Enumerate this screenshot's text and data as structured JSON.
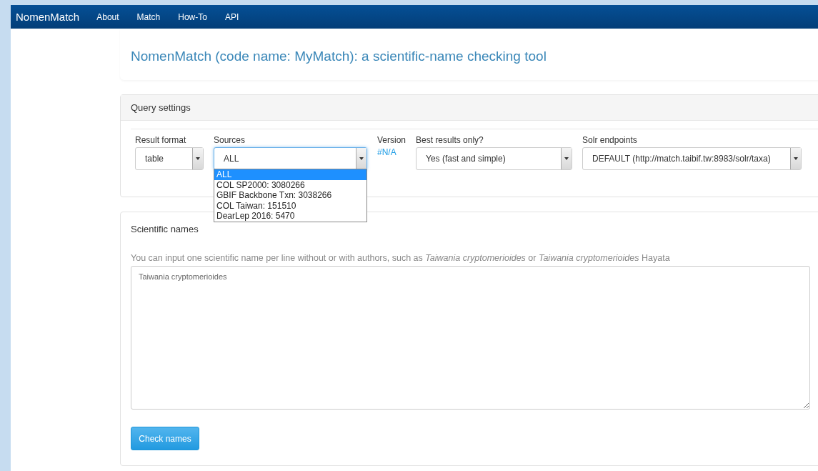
{
  "navbar": {
    "brand": "NomenMatch",
    "items": [
      {
        "label": "About"
      },
      {
        "label": "Match"
      },
      {
        "label": "How-To"
      },
      {
        "label": "API"
      }
    ]
  },
  "title": "NomenMatch (code name: MyMatch): a scientific-name checking tool",
  "query_settings": {
    "heading": "Query settings",
    "result_format": {
      "label": "Result format",
      "value": "table"
    },
    "sources": {
      "label": "Sources",
      "value": "ALL",
      "expanded": true,
      "options": [
        {
          "label": "ALL",
          "selected": true
        },
        {
          "label": "COL SP2000: 3080266",
          "selected": false
        },
        {
          "label": "GBIF Backbone Txn: 3038266",
          "selected": false
        },
        {
          "label": "COL Taiwan: 151510",
          "selected": false
        },
        {
          "label": "DearLep 2016: 5470",
          "selected": false
        }
      ]
    },
    "version": {
      "label": "Version",
      "value": "#N/A"
    },
    "best_results_only": {
      "label": "Best results only?",
      "value": "Yes (fast and simple)"
    },
    "solr_endpoints": {
      "label": "Solr endpoints",
      "value": "DEFAULT (http://match.taibif.tw:8983/solr/taxa)"
    }
  },
  "scientific_names": {
    "heading": "Scientific names",
    "hint": "You can input one scientific name per line without or with authors, such as *Taiwania cryptomerioides* or *Taiwania cryptomerioides* Hayata",
    "value": "Taiwania cryptomerioides",
    "button": "Check names"
  }
}
